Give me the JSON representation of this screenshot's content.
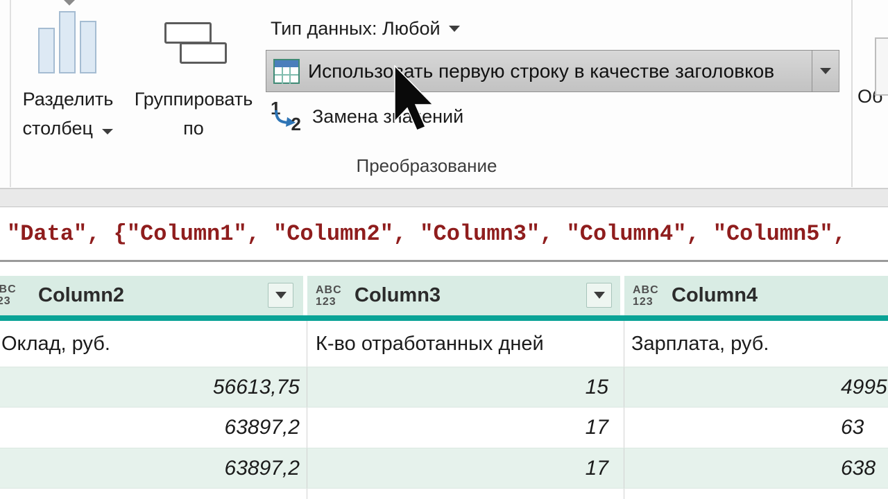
{
  "ribbon": {
    "split_column": {
      "line1": "Разделить",
      "line2": "столбец"
    },
    "group_by": {
      "line1": "Группировать",
      "line2": "по"
    },
    "data_type_label": "Тип данных: Любой",
    "use_first_row_label": "Использовать первую строку в качестве заголовков",
    "replace_values_label": "Замена значений",
    "replace_values_icon": {
      "one": "1",
      "two": "2"
    },
    "group_caption": "Преобразование",
    "next_group_partial": "Об"
  },
  "formula_bar": {
    "text": "\"Data\", {\"Column1\", \"Column2\", \"Column3\", \"Column4\", \"Column5\","
  },
  "grid": {
    "type_icon": {
      "top": "ABC",
      "bottom": "123"
    },
    "columns": [
      "Column2",
      "Column3",
      "Column4"
    ],
    "rows": [
      {
        "c1": "Оклад, руб.",
        "c2": "К-во отработанных дней",
        "c3": "Зарплата, руб."
      },
      {
        "c1": "56613,75",
        "c2": "15",
        "c3": "4995"
      },
      {
        "c1": "63897,2",
        "c2": "17",
        "c3": "63"
      },
      {
        "c1": "63897,2",
        "c2": "17",
        "c3": "638"
      }
    ]
  },
  "colors": {
    "teal_accent": "#0aa396",
    "header_bg": "#d9ece4",
    "alt_row_bg": "#e6f2ec",
    "formula_text": "#8f1d1d",
    "button_face": "#c2c2c2",
    "button_highlight_border": "#8f8f8f"
  }
}
